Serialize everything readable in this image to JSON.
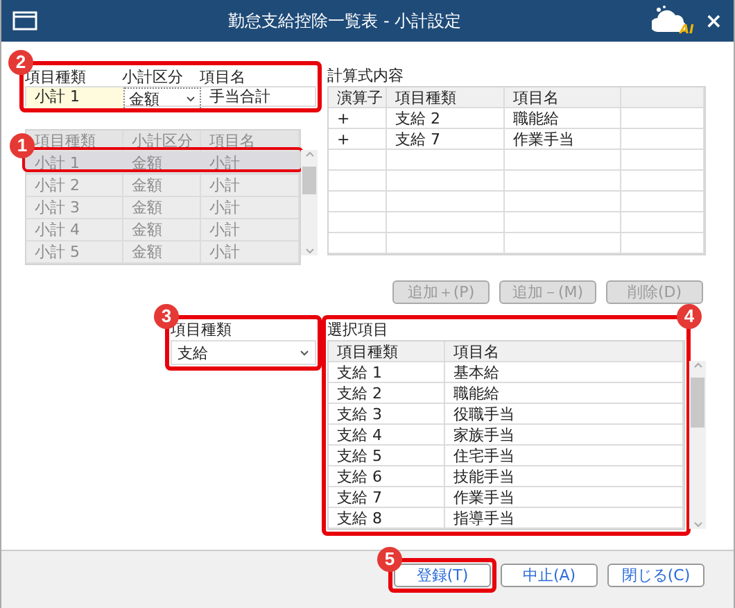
{
  "window": {
    "title": "勤怠支給控除一覧表 - 小計設定",
    "logo_text": "AI",
    "close": "×"
  },
  "form": {
    "callout": "2",
    "labels": [
      "項目種類",
      "小計区分",
      "項目名"
    ],
    "kind_value": "小計 1",
    "category_value": "金額",
    "name_value": "手当合計"
  },
  "subtotal_list": {
    "disabled": true,
    "columns": [
      "項目種類",
      "小計区分",
      "項目名"
    ],
    "rows": [
      {
        "cells": [
          "小計 1",
          "金額",
          "小計"
        ],
        "selected": true,
        "callout": "1"
      },
      {
        "cells": [
          "小計 2",
          "金額",
          "小計"
        ],
        "selected": false
      },
      {
        "cells": [
          "小計 3",
          "金額",
          "小計"
        ],
        "selected": false
      },
      {
        "cells": [
          "小計 4",
          "金額",
          "小計"
        ],
        "selected": false
      },
      {
        "cells": [
          "小計 5",
          "金額",
          "小計"
        ],
        "selected": false
      }
    ]
  },
  "formula": {
    "label": "計算式内容",
    "columns": [
      "演算子",
      "項目種類",
      "項目名"
    ],
    "rows": [
      [
        "+",
        "支給 2",
        "職能給"
      ],
      [
        "+",
        "支給 7",
        "作業手当"
      ]
    ]
  },
  "formula_buttons": [
    {
      "label": "追加＋(P)",
      "disabled": true
    },
    {
      "label": "追加－(M)",
      "disabled": true
    },
    {
      "label": "削除(D)",
      "disabled": true
    }
  ],
  "item_type": {
    "callout": "3",
    "label": "項目種類",
    "value": "支給"
  },
  "selection": {
    "callout": "4",
    "label": "選択項目",
    "columns": [
      "項目種類",
      "項目名"
    ],
    "rows": [
      [
        "支給 1",
        "基本給"
      ],
      [
        "支給 2",
        "職能給"
      ],
      [
        "支給 3",
        "役職手当"
      ],
      [
        "支給 4",
        "家族手当"
      ],
      [
        "支給 5",
        "住宅手当"
      ],
      [
        "支給 6",
        "技能手当"
      ],
      [
        "支給 7",
        "作業手当"
      ],
      [
        "支給 8",
        "指導手当"
      ]
    ]
  },
  "footer_buttons": [
    {
      "label": "登録(T)",
      "callout": "5"
    },
    {
      "label": "中止(A)"
    },
    {
      "label": "閉じる(C)"
    }
  ]
}
